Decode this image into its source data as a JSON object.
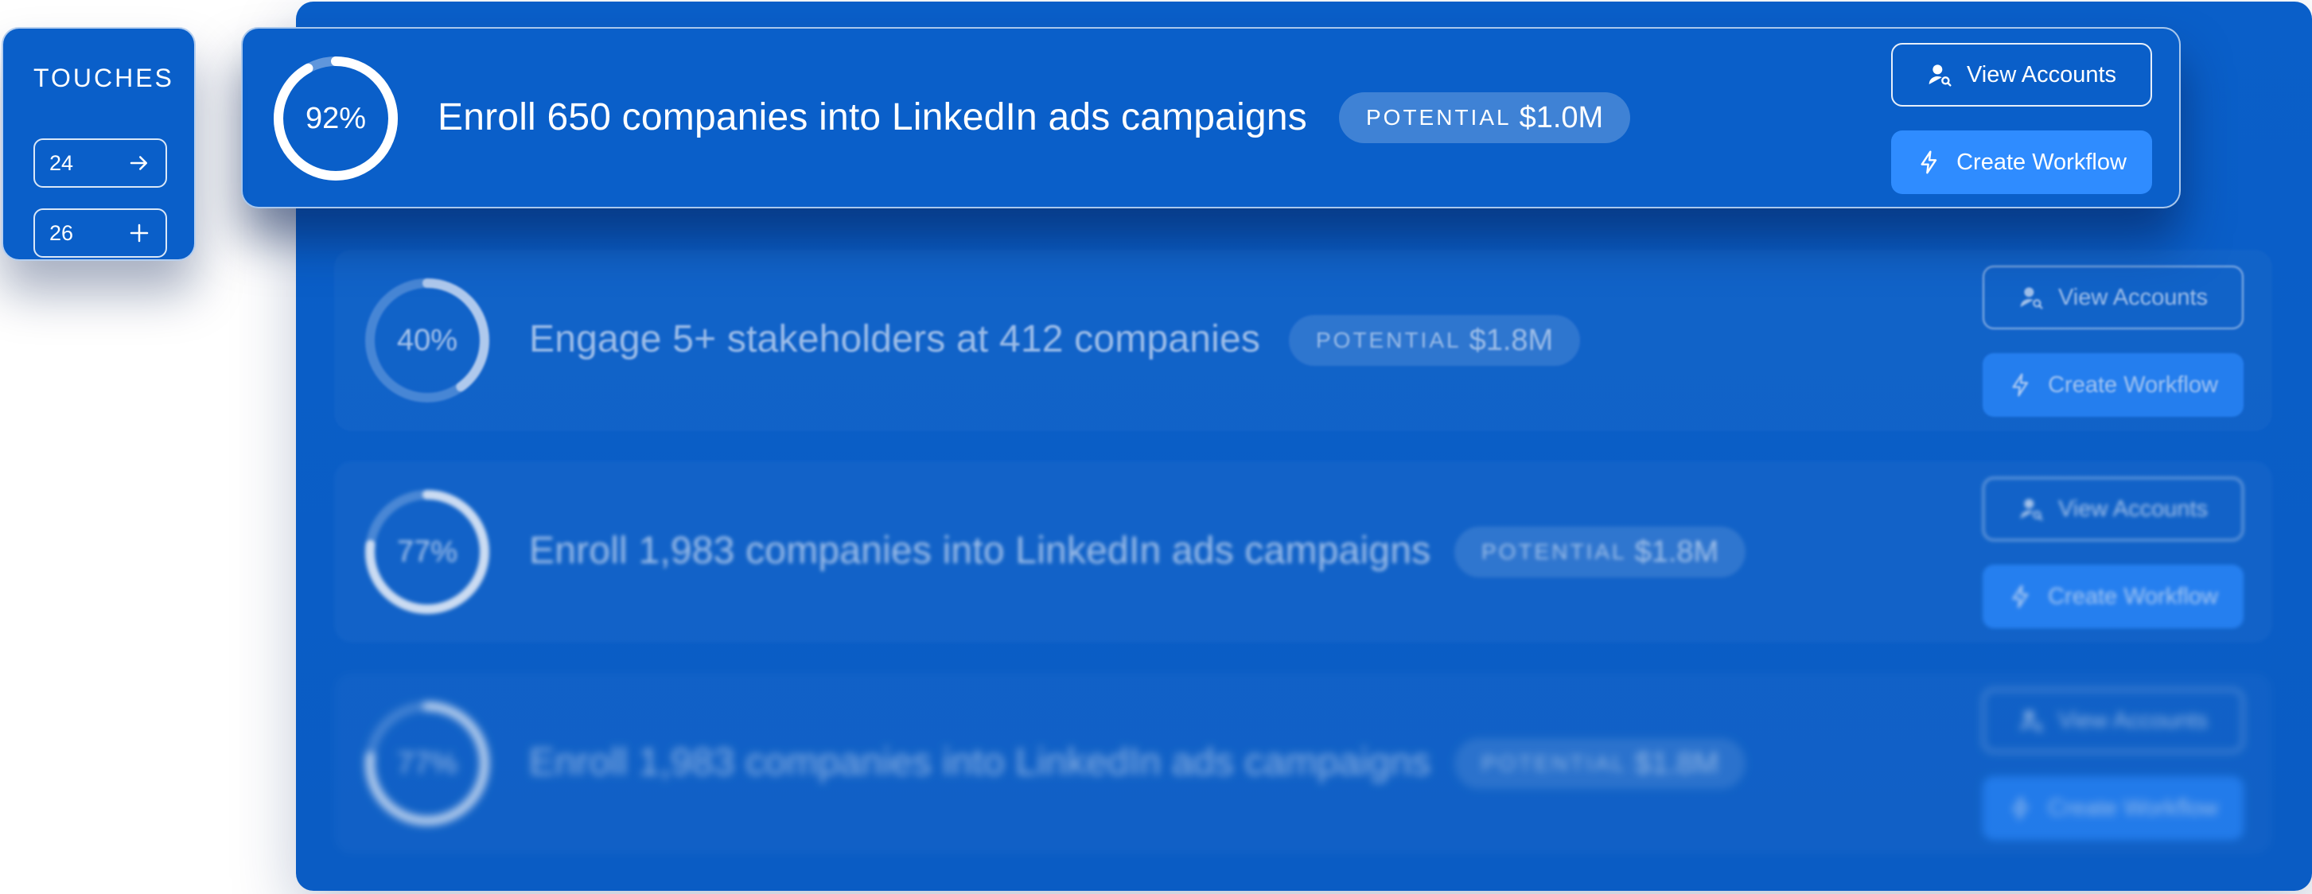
{
  "touches": {
    "heading": "TOUCHES",
    "items": [
      {
        "value": "24",
        "icon": "arrow-right-icon"
      },
      {
        "value": "26",
        "icon": "plus-icon"
      }
    ]
  },
  "goals": [
    {
      "percent_label": "92%",
      "progress": 0.92,
      "title": "Enroll 650 companies into LinkedIn ads campaigns",
      "potential_label": "POTENTIAL",
      "potential_amount": "$1.0M",
      "view_accounts_label": "View Accounts",
      "create_workflow_label": "Create Workflow"
    },
    {
      "percent_label": "40%",
      "progress": 0.4,
      "title": "Engage 5+ stakeholders at 412 companies",
      "potential_label": "POTENTIAL",
      "potential_amount": "$1.8M",
      "view_accounts_label": "View Accounts",
      "create_workflow_label": "Create Workflow"
    },
    {
      "percent_label": "77%",
      "progress": 0.77,
      "title": "Enroll 1,983 companies into LinkedIn ads campaigns",
      "potential_label": "POTENTIAL",
      "potential_amount": "$1.8M",
      "view_accounts_label": "View Accounts",
      "create_workflow_label": "Create Workflow"
    },
    {
      "percent_label": "77%",
      "progress": 0.77,
      "title": "Enroll 1,983 companies into LinkedIn ads campaigns",
      "potential_label": "POTENTIAL",
      "potential_amount": "$1.8M",
      "view_accounts_label": "View Accounts",
      "create_workflow_label": "Create Workflow"
    }
  ],
  "colors": {
    "panel": "#0a5fc9",
    "primary_button": "#2f8cff",
    "ring_track": "rgba(255,255,255,0.35)",
    "ring_fill": "#ffffff"
  }
}
